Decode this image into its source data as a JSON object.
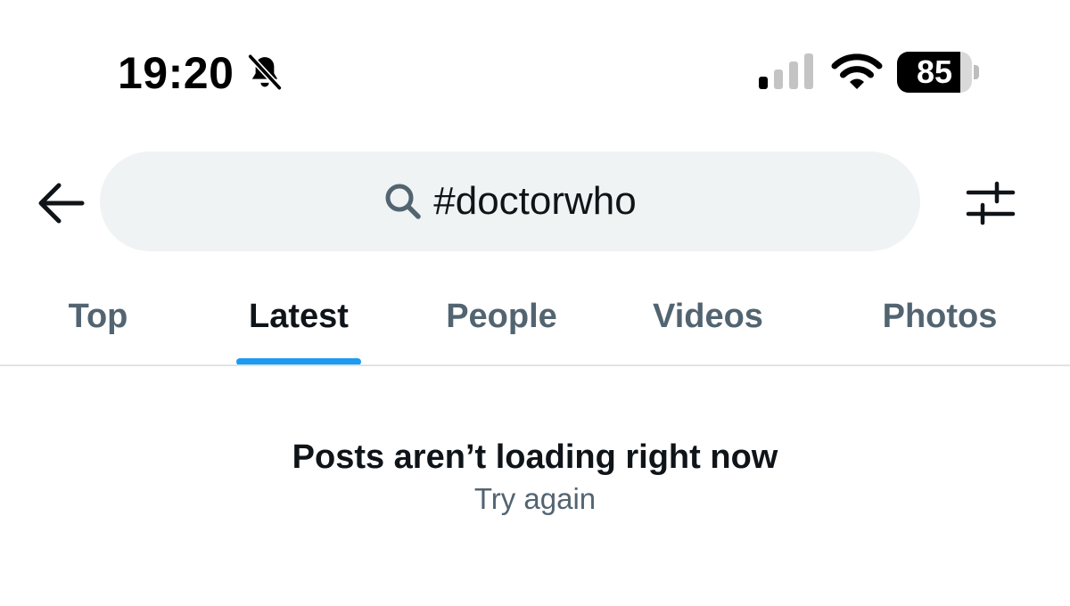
{
  "status_bar": {
    "time": "19:20",
    "bell_icon": "bell-slash-icon",
    "signal_icon": "cellular-signal-icon",
    "signal_bars": 1,
    "signal_bars_total": 4,
    "wifi_icon": "wifi-icon",
    "battery_percent": "85",
    "battery_level": 0.85
  },
  "header": {
    "back_icon": "arrow-left-icon",
    "search": {
      "icon": "search-icon",
      "query": "#doctorwho"
    },
    "filter_icon": "sliders-icon"
  },
  "tabs": [
    {
      "label": "Top",
      "active": false
    },
    {
      "label": "Latest",
      "active": true
    },
    {
      "label": "People",
      "active": false
    },
    {
      "label": "Videos",
      "active": false
    },
    {
      "label": "Photos",
      "active": false
    }
  ],
  "message": {
    "title": "Posts aren’t loading right now",
    "retry_label": "Try again"
  },
  "colors": {
    "accent": "#1d9bf0",
    "text_primary": "#0f1419",
    "text_secondary": "#536471",
    "search_background": "#eff3f4",
    "divider": "#dfe3e6"
  }
}
